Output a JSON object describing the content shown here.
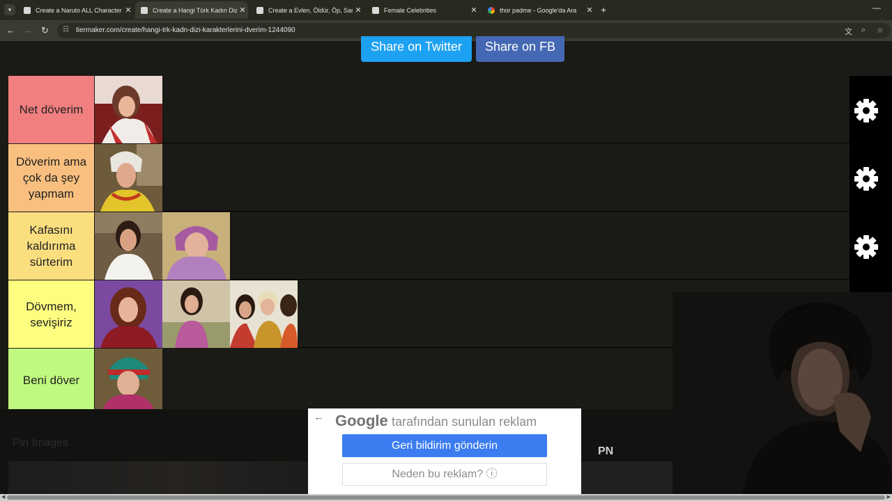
{
  "browser": {
    "tabs": [
      {
        "title": "Create a Naruto ALL Character",
        "favicon": "tiermaker-icon",
        "active": false
      },
      {
        "title": "Create a Hangi Türk Kadın Dizi",
        "favicon": "tiermaker-icon",
        "active": true
      },
      {
        "title": "Create a Evlen, Öldür, Öp, Sarıl",
        "favicon": "tiermaker-icon",
        "active": false
      },
      {
        "title": "Female Celebrities",
        "favicon": "tiermaker-icon",
        "active": false
      },
      {
        "title": "thor padme - Google'da Ara",
        "favicon": "google-icon",
        "active": false
      }
    ],
    "close_symbol": "✕",
    "new_tab_symbol": "+",
    "minimize_symbol": "—",
    "url": "tiermaker.com/create/hangi-trk-kadn-dizi-karakterlerini-dverim-1244090"
  },
  "share": {
    "twitter_label": "Share on Twitter",
    "facebook_label": "Share on FB"
  },
  "tiers": [
    {
      "label": "Net döverim",
      "color": "#f27f7f",
      "items": 1
    },
    {
      "label": "Döverim ama çok da şey yapmam",
      "color": "#f9bf7f",
      "items": 1
    },
    {
      "label": "Kafasını kaldırıma sürterim",
      "color": "#fbdf7f",
      "items": 2
    },
    {
      "label": "Dövmem, sevişiriz",
      "color": "#fdfd7f",
      "items": 3
    },
    {
      "label": "Beni döver",
      "color": "#bff97f",
      "items": 1
    }
  ],
  "lower": {
    "pin_images_label": "Pin Images",
    "overlay_text": "PN"
  },
  "ad": {
    "google_label": "Google",
    "sponsored_text": "tarafından sunulan reklam",
    "feedback_button": "Geri bildirim gönderin",
    "why_button": "Neden bu reklam?",
    "info_symbol": "ⓘ",
    "back_symbol": "←"
  },
  "colors": {
    "twitter": "#1da1f2",
    "facebook": "#4468b3",
    "feedback_button": "#3b7cf0"
  }
}
